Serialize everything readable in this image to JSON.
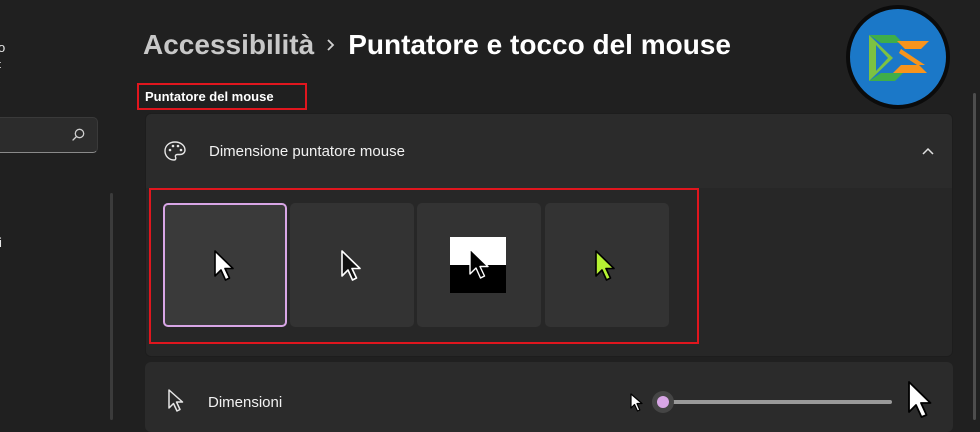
{
  "sidebar": {
    "fragment_1": "o",
    "fragment_2": "t",
    "fragment_3": "i",
    "search_icon": "search-icon"
  },
  "breadcrumb": {
    "parent": "Accessibilità",
    "separator_icon": "chevron-right-icon",
    "current": "Puntatore e tocco del mouse"
  },
  "section": {
    "title": "Puntatore del mouse"
  },
  "pointer_style_card": {
    "icon": "palette-icon",
    "label": "Dimensione puntatore mouse",
    "expanded": true,
    "options": [
      {
        "name": "white",
        "selected": true
      },
      {
        "name": "black",
        "selected": false
      },
      {
        "name": "inverted",
        "selected": false
      },
      {
        "name": "custom",
        "selected": false,
        "color": "#b6f233"
      }
    ]
  },
  "size_card": {
    "icon": "pointer-icon",
    "label": "Dimensioni",
    "slider_value": 0.0
  },
  "colors": {
    "accent": "#d8a6e6",
    "highlight": "#e0161e",
    "custom_pointer": "#b6f233",
    "logo_bg": "#1b78c8"
  }
}
